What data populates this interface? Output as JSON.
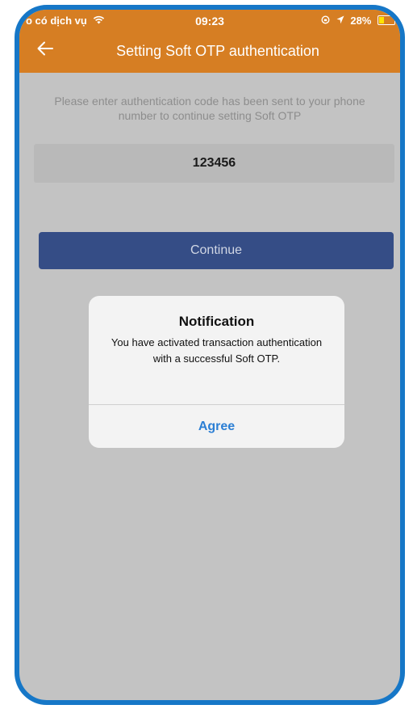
{
  "status_bar": {
    "carrier": "o có dịch vụ",
    "time": "09:23",
    "battery_percent": "28%",
    "icons": {
      "wifi": "wifi-icon",
      "screen_lock": "rotation-lock-icon",
      "location": "location-arrow-icon",
      "battery": "battery-charging-icon"
    }
  },
  "header": {
    "back_icon": "arrow-left-icon",
    "title": "Setting Soft OTP authentication"
  },
  "main": {
    "instruction": "Please enter authentication code has been sent to your phone number to continue setting Soft OTP",
    "code_value": "123456",
    "continue_label": "Continue"
  },
  "dialog": {
    "title": "Notification",
    "message": "You have activated transaction authentication with a successful Soft OTP.",
    "agree_label": "Agree"
  },
  "colors": {
    "header_background": "#d67e23",
    "screen_background": "#c3c3c3",
    "button_background": "#354d86",
    "frame_border": "#1677c7",
    "dialog_action": "#2c7fd4"
  }
}
